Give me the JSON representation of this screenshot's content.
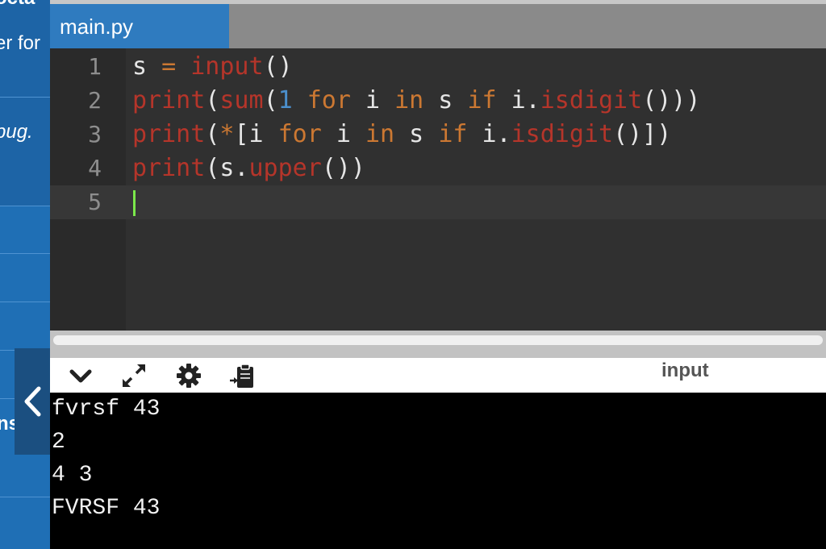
{
  "sidebar": {
    "text_1": "octa",
    "text_2": "er for",
    "text_3": "bug.",
    "text_4": "ns"
  },
  "tabs": [
    {
      "label": "main.py",
      "active": true
    }
  ],
  "editor": {
    "line_numbers": [
      "1",
      "2",
      "3",
      "4",
      "5"
    ],
    "lines": [
      "s = input()",
      "print(sum(1 for i in s if i.isdigit()))",
      "print(*[i for i in s if i.isdigit()])",
      "print(s.upper())",
      ""
    ],
    "active_line": 5
  },
  "console_toolbar": {
    "icons": [
      "chevron-down-icon",
      "expand-icon",
      "gear-icon",
      "clipboard-icon"
    ],
    "input_label": "input"
  },
  "console": {
    "output_lines": [
      "fvrsf 43",
      "2",
      "4 3",
      "FVRSF 43"
    ]
  },
  "colors": {
    "sidebar_blue": "#1f6fb5",
    "tab_active": "#2f7bbf",
    "editor_bg": "#303030",
    "keyword": "#cc7832",
    "function": "#b5352a",
    "number": "#4b8fcc",
    "cursor": "#7be84b"
  }
}
